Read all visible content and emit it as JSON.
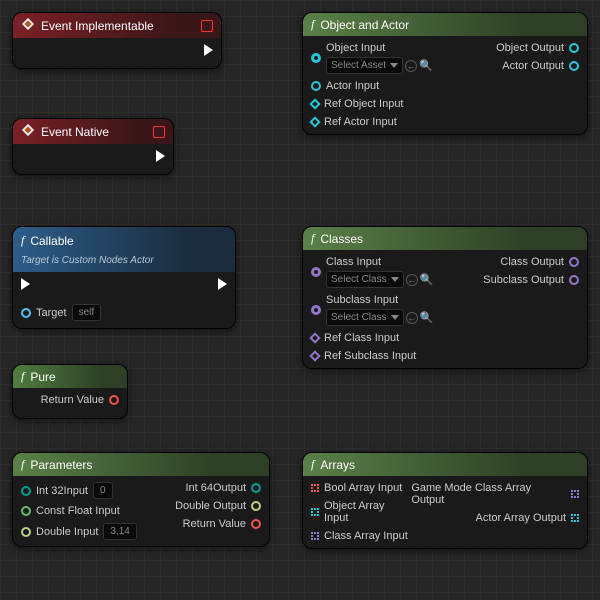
{
  "nodes": {
    "evImpl": {
      "title": "Event Implementable"
    },
    "evNat": {
      "title": "Event Native"
    },
    "callable": {
      "title": "Callable",
      "sub": "Target is Custom Nodes Actor",
      "target": "Target",
      "self": "self"
    },
    "pure": {
      "title": "Pure",
      "ret": "Return Value"
    },
    "objAct": {
      "title": "Object and Actor",
      "objIn": "Object Input",
      "selAsset": "Select Asset",
      "actIn": "Actor Input",
      "refObj": "Ref Object Input",
      "refAct": "Ref Actor Input",
      "objOut": "Object Output",
      "actOut": "Actor Output"
    },
    "classes": {
      "title": "Classes",
      "clsIn": "Class Input",
      "selCls": "Select Class",
      "subIn": "Subclass Input",
      "refCls": "Ref Class Input",
      "refSub": "Ref Subclass Input",
      "clsOut": "Class Output",
      "subOut": "Subclass Output"
    },
    "params": {
      "title": "Parameters",
      "i32": "Int 32Input",
      "i32v": "0",
      "cf": "Const Float Input",
      "dbl": "Double Input",
      "dblv": "3,14",
      "i64": "Int 64Output",
      "dout": "Double Output",
      "ret": "Return Value"
    },
    "arrays": {
      "title": "Arrays",
      "bool": "Bool Array Input",
      "obj": "Object Array Input",
      "cls": "Class Array Input",
      "gm": "Game Mode Class Array Output",
      "act": "Actor Array Output"
    }
  },
  "colors": {
    "cyan": "#26c6da",
    "blue": "#4fc3f7",
    "red": "#ef5350",
    "purple": "#9575cd",
    "green": "#66bb6a",
    "teal": "#00a08d",
    "lime": "#b8d183"
  }
}
